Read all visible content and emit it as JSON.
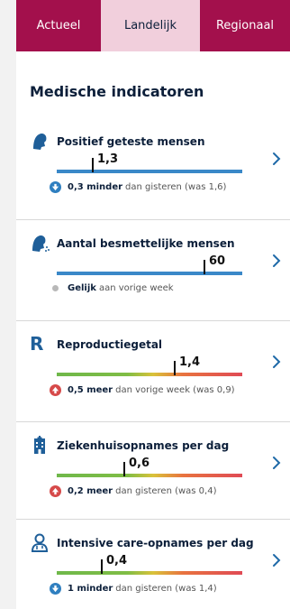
{
  "tabs": [
    {
      "label": "Actueel"
    },
    {
      "label": "Landelijk"
    },
    {
      "label": "Regionaal"
    }
  ],
  "section_title": "Medische indicatoren",
  "colors": {
    "brand": "#a3104c",
    "tab_active": "#f1cfdc",
    "bar_blue": "#3a88c8",
    "arrow_up_red": "#d64a4a",
    "arrow_down_blue": "#2f7fc0"
  },
  "indicators": [
    {
      "title": "Positief geteste mensen",
      "icon": "person-head-icon",
      "value": "1,3",
      "change_amount": "0,3 minder",
      "change_text": "dan gisteren (was 1,6)",
      "trend": "down",
      "marker_fraction": 0.19,
      "bar": "blue"
    },
    {
      "title": "Aantal besmettelijke mensen",
      "icon": "person-coughing-icon",
      "value": "60",
      "change_amount": "Gelijk",
      "change_text": "aan vorige week",
      "trend": "equal",
      "marker_fraction": 0.79,
      "bar": "blue"
    },
    {
      "title": "Reproductiegetal",
      "icon": "letter-r-icon",
      "icon_text": "R",
      "value": "1,4",
      "change_amount": "0,5 meer",
      "change_text": "dan vorige week (was 0,9)",
      "trend": "up",
      "marker_fraction": 0.63,
      "bar": "gradient"
    },
    {
      "title": "Ziekenhuisopnames per dag",
      "icon": "hospital-icon",
      "value": "0,6",
      "change_amount": "0,2 meer",
      "change_text": "dan gisteren (was 0,4)",
      "trend": "up",
      "marker_fraction": 0.36,
      "bar": "gradient"
    },
    {
      "title": "Intensive care-opnames per dag",
      "icon": "doctor-icon",
      "value": "0,4",
      "change_amount": "1 minder",
      "change_text": "dan gisteren (was 1,4)",
      "trend": "down",
      "marker_fraction": 0.24,
      "bar": "gradient"
    }
  ]
}
